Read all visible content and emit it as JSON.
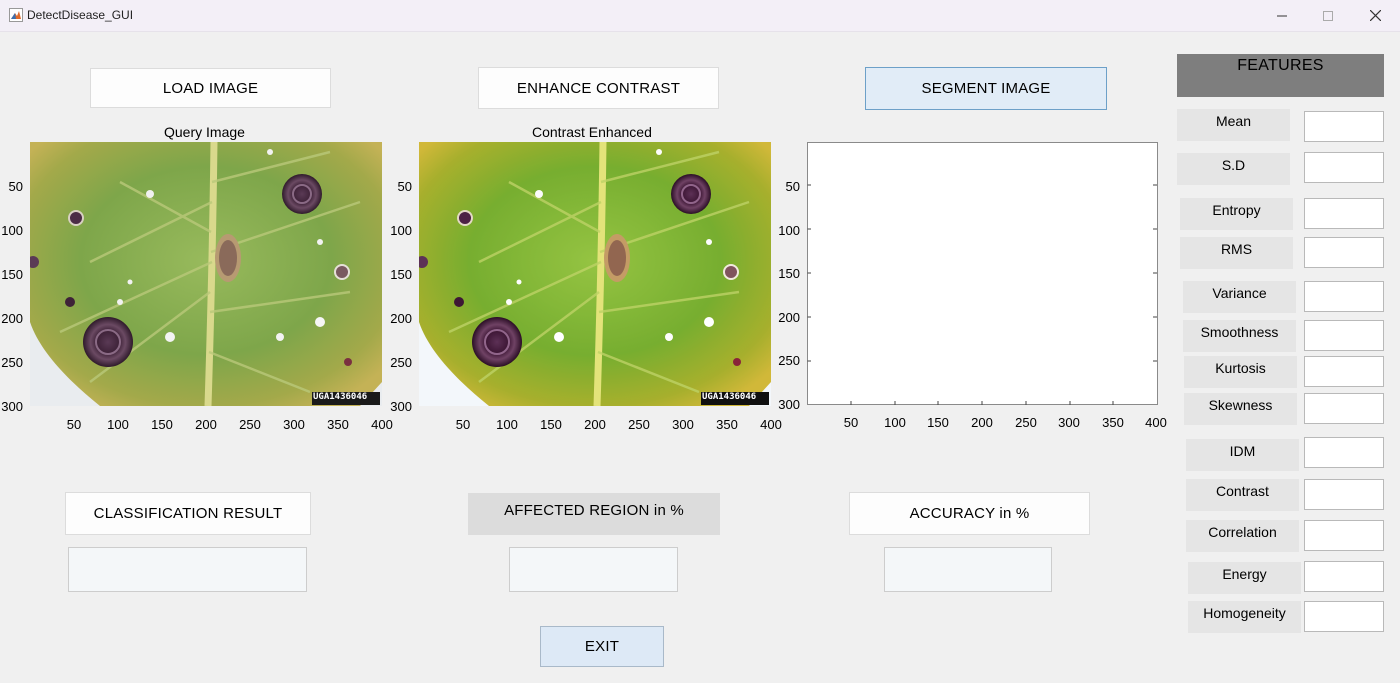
{
  "window": {
    "title": "DetectDisease_GUI"
  },
  "buttons": {
    "load": "LOAD IMAGE",
    "enhance": "ENHANCE CONTRAST",
    "segment": "SEGMENT IMAGE",
    "classification": "CLASSIFICATION RESULT",
    "affected": "AFFECTED REGION in %",
    "accuracy": "ACCURACY in %",
    "exit": "EXIT"
  },
  "axes": {
    "query_title": "Query Image",
    "enhanced_title": "Contrast Enhanced",
    "y_ticks": [
      "50",
      "100",
      "150",
      "200",
      "250",
      "300"
    ],
    "x_ticks": [
      "50",
      "100",
      "150",
      "200",
      "250",
      "300",
      "350",
      "400"
    ],
    "watermark": "UGA1436046"
  },
  "features": {
    "header": "FEATURES",
    "labels": [
      "Mean",
      "S.D",
      "Entropy",
      "RMS",
      "Variance",
      "Smoothness",
      "Kurtosis",
      "Skewness",
      "IDM",
      "Contrast",
      "Correlation",
      "Energy",
      "Homogeneity"
    ]
  },
  "colors": {
    "selected_button": "#e1ecf7",
    "features_header": "#7e7e7e",
    "leaf_green": "#7fa84a"
  },
  "icons": {
    "app": "matlab-icon",
    "minimize": "minimize-icon",
    "maximize": "maximize-icon",
    "close": "close-icon"
  }
}
